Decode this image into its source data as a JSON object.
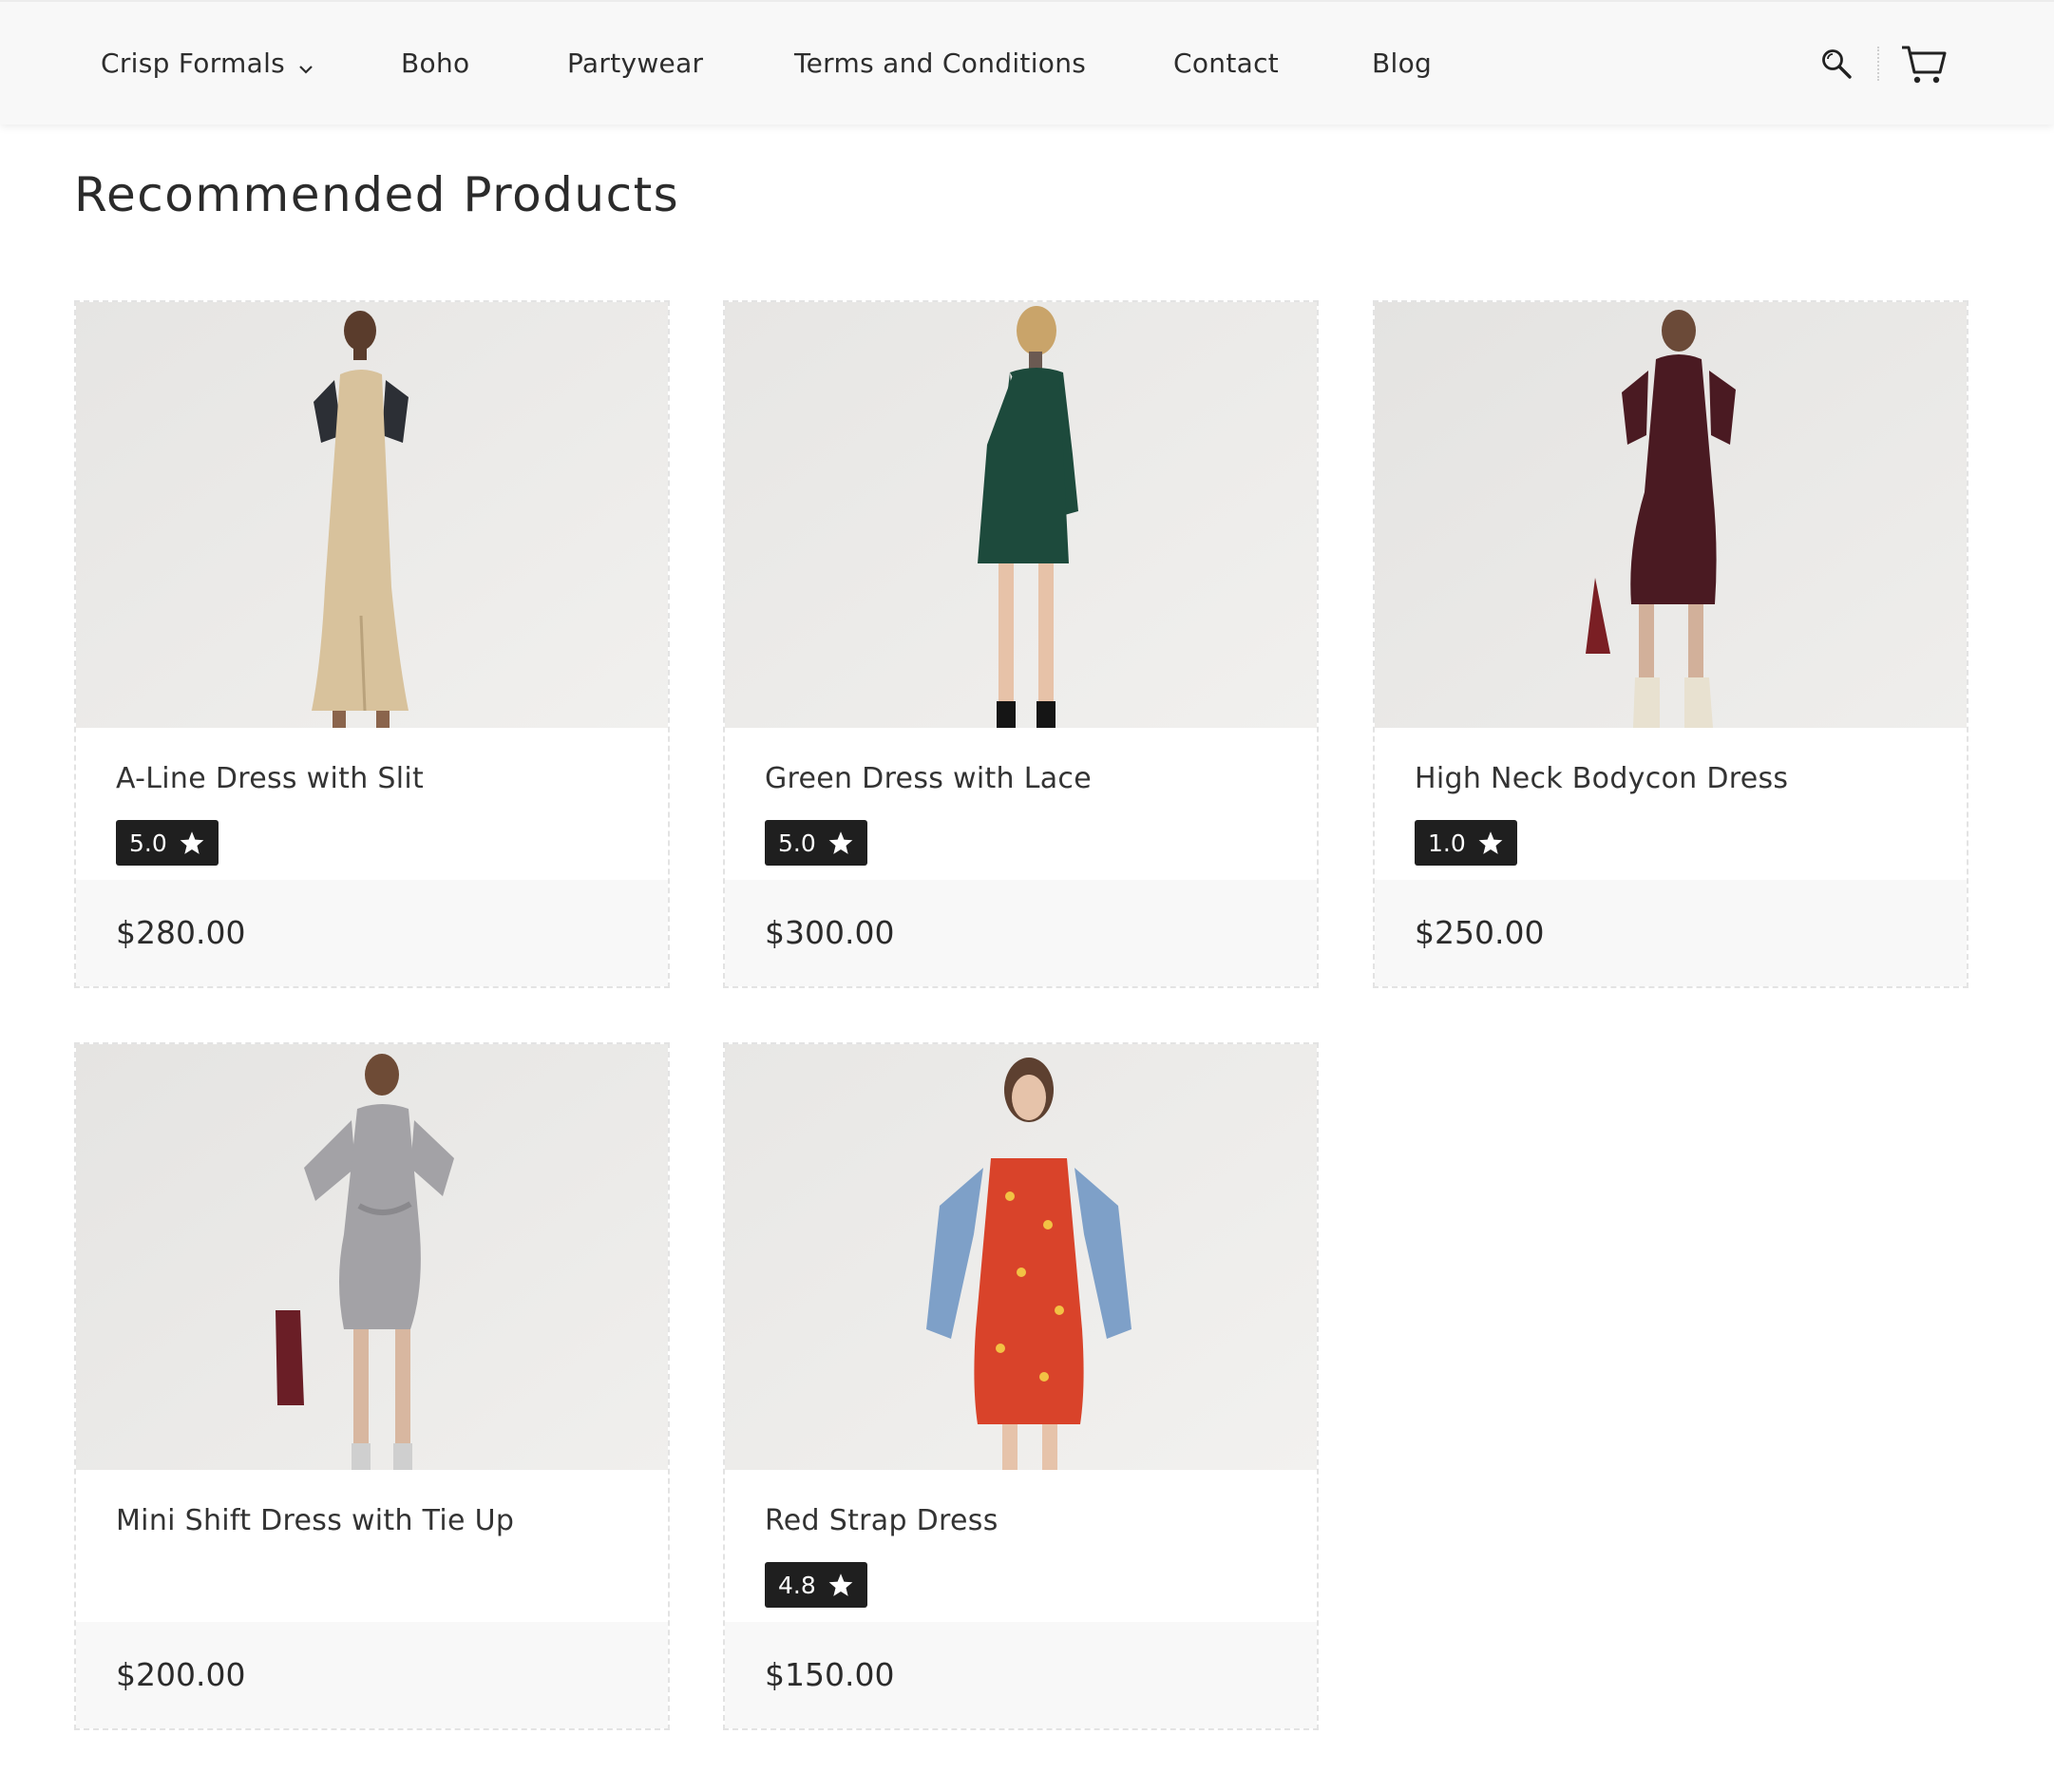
{
  "nav": {
    "items": [
      {
        "label": "Crisp Formals",
        "has_dropdown": true
      },
      {
        "label": "Boho"
      },
      {
        "label": "Partywear"
      },
      {
        "label": "Terms and Conditions"
      },
      {
        "label": "Contact"
      },
      {
        "label": "Blog"
      }
    ],
    "icons": [
      "search-icon",
      "cart-icon"
    ]
  },
  "section": {
    "title": "Recommended Products"
  },
  "products": [
    {
      "name": "A-Line Dress with Slit",
      "rating": "5.0",
      "price": "$280.00",
      "dress_color": "#d8c29c"
    },
    {
      "name": "Green Dress with Lace",
      "rating": "5.0",
      "price": "$300.00",
      "dress_color": "#1d4a3c"
    },
    {
      "name": "High Neck Bodycon Dress",
      "rating": "1.0",
      "price": "$250.00",
      "dress_color": "#4a1a22"
    },
    {
      "name": "Mini Shift Dress with Tie Up",
      "rating": null,
      "price": "$200.00",
      "dress_color": "#a3a2a6"
    },
    {
      "name": "Red Strap Dress",
      "rating": "4.8",
      "price": "$150.00",
      "dress_color": "#d9432a"
    }
  ],
  "colors": {
    "badge_bg": "#1f1f1f",
    "price_bar_bg": "#f8f8f8",
    "nav_bg": "#f8f8f8"
  }
}
